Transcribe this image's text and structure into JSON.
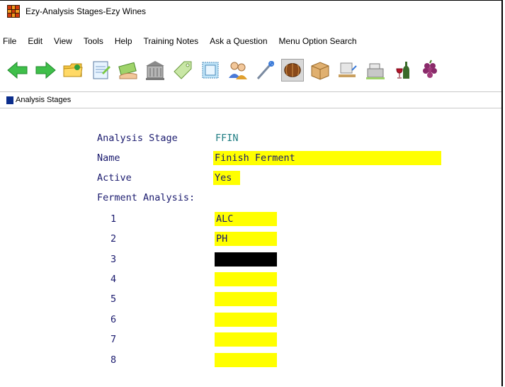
{
  "window": {
    "title": "Ezy-Analysis Stages-Ezy Wines"
  },
  "menubar": {
    "items": [
      "File",
      "Edit",
      "View",
      "Tools",
      "Help",
      "Training Notes",
      "Ask a Question",
      "Menu Option Search"
    ]
  },
  "toolbar": {
    "icons": [
      "back-arrow-icon",
      "forward-arrow-icon",
      "folder-icon",
      "notepad-icon",
      "money-hand-icon",
      "building-icon",
      "tag-icon",
      "stamp-icon",
      "people-icon",
      "wrench-icon",
      "barrel-icon",
      "box-icon",
      "pallet-icon",
      "cash-register-icon",
      "wine-bottles-icon",
      "grapes-icon"
    ]
  },
  "panel": {
    "title": "Analysis Stages"
  },
  "form": {
    "analysis_stage_label": "Analysis Stage",
    "analysis_stage_value": "FFIN",
    "name_label": "Name",
    "name_value": "Finish Ferment",
    "active_label": "Active",
    "active_value": "Yes",
    "ferment_analysis_label": "Ferment Analysis:",
    "ferment_rows": [
      {
        "num": "1",
        "value": "ALC"
      },
      {
        "num": "2",
        "value": "PH"
      },
      {
        "num": "3",
        "value": ""
      },
      {
        "num": "4",
        "value": ""
      },
      {
        "num": "5",
        "value": ""
      },
      {
        "num": "6",
        "value": ""
      },
      {
        "num": "7",
        "value": ""
      },
      {
        "num": "8",
        "value": ""
      }
    ]
  },
  "colors": {
    "field_bg": "#ffff00",
    "label_text": "#1a1a6e",
    "stage_code_text": "#1f7d83",
    "panel_marker": "#0b2d8c"
  }
}
